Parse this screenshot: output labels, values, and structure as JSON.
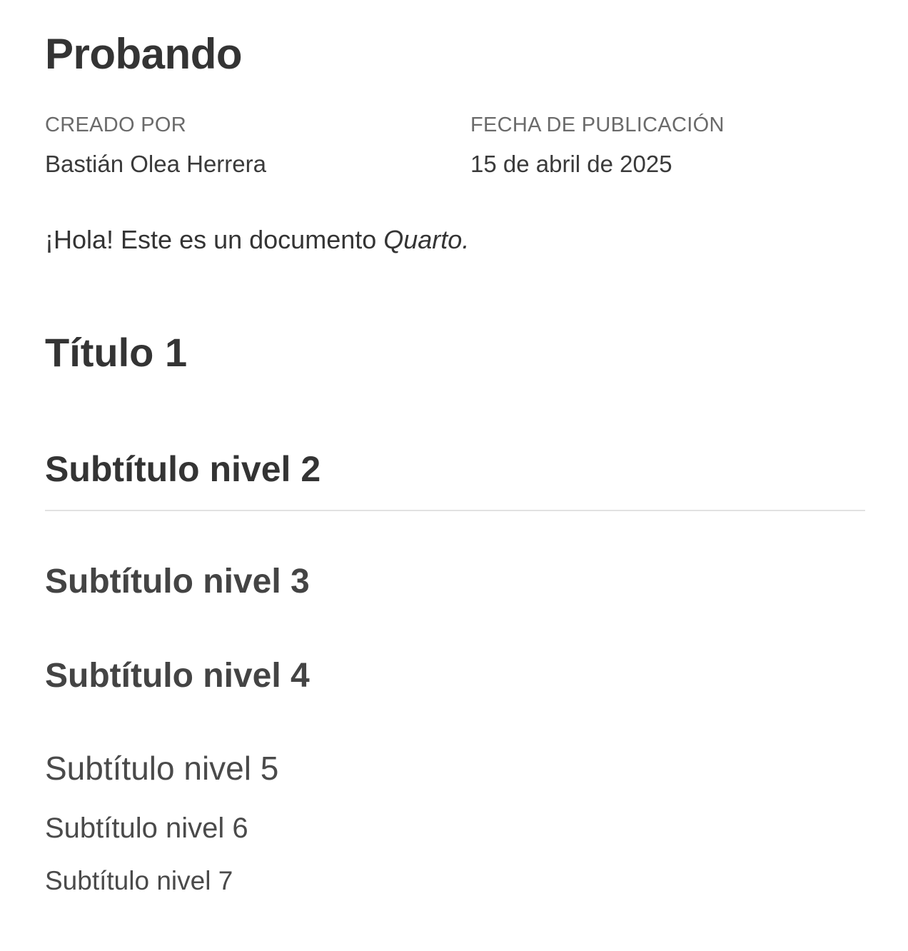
{
  "document": {
    "title": "Probando",
    "meta": {
      "author_label": "CREADO POR",
      "author": "Bastián Olea Herrera",
      "date_label": "FECHA DE PUBLICACIÓN",
      "date": "15 de abril de 2025"
    },
    "intro": {
      "text": "¡Hola! Este es un documento ",
      "emphasis": "Quarto."
    },
    "headings": {
      "h1": "Título 1",
      "h2": "Subtítulo nivel 2",
      "h3": "Subtítulo nivel 3",
      "h4": "Subtítulo nivel 4",
      "h5": "Subtítulo nivel 5",
      "h6": "Subtítulo nivel 6",
      "h7": "Subtítulo nivel 7"
    }
  }
}
